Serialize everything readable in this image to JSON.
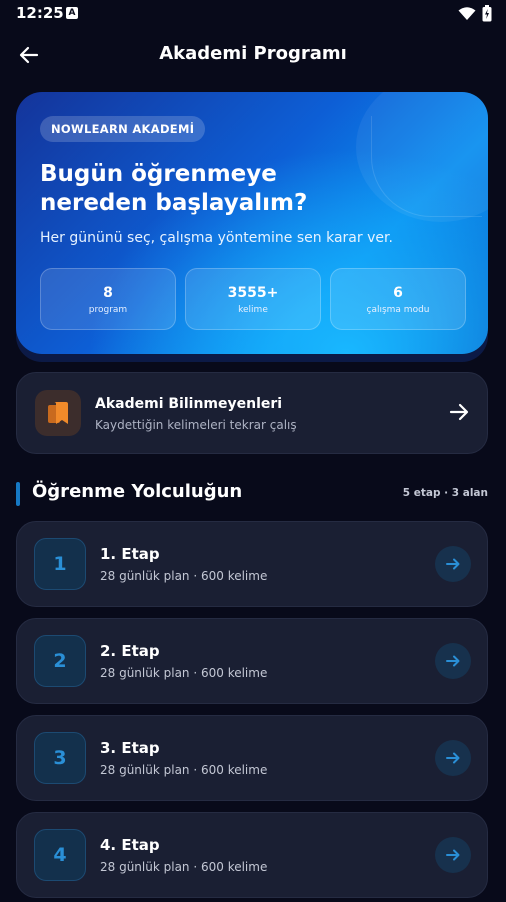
{
  "status_bar": {
    "time": "12:25",
    "notification_glyph": "A"
  },
  "header": {
    "title": "Akademi Programı"
  },
  "hero": {
    "badge": "NOWLEARN AKADEMİ",
    "heading_line1": "Bugün öğrenmeye",
    "heading_line2": "nereden başlayalım?",
    "subtitle": "Her gününü seç, çalışma yöntemine sen karar ver.",
    "stats": [
      {
        "value": "8",
        "label": "program"
      },
      {
        "value": "3555+",
        "label": "kelime"
      },
      {
        "value": "6",
        "label": "çalışma modu"
      }
    ]
  },
  "unknowns": {
    "title": "Akademi Bilinmeyenleri",
    "subtitle": "Kaydettiğin kelimeleri tekrar çalış",
    "icon": "bookmark-books-icon",
    "icon_color": "#f08a2a"
  },
  "journey": {
    "title": "Öğrenme Yolculuğun",
    "meta": "5 etap · 3 alan",
    "accent": "#1679c4",
    "stages": [
      {
        "number": "1",
        "title": "1. Etap",
        "subtitle": "28 günlük plan · 600 kelime"
      },
      {
        "number": "2",
        "title": "2. Etap",
        "subtitle": "28 günlük plan · 600 kelime"
      },
      {
        "number": "3",
        "title": "3. Etap",
        "subtitle": "28 günlük plan · 600 kelime"
      },
      {
        "number": "4",
        "title": "4. Etap",
        "subtitle": "28 günlük plan · 600 kelime"
      }
    ]
  }
}
